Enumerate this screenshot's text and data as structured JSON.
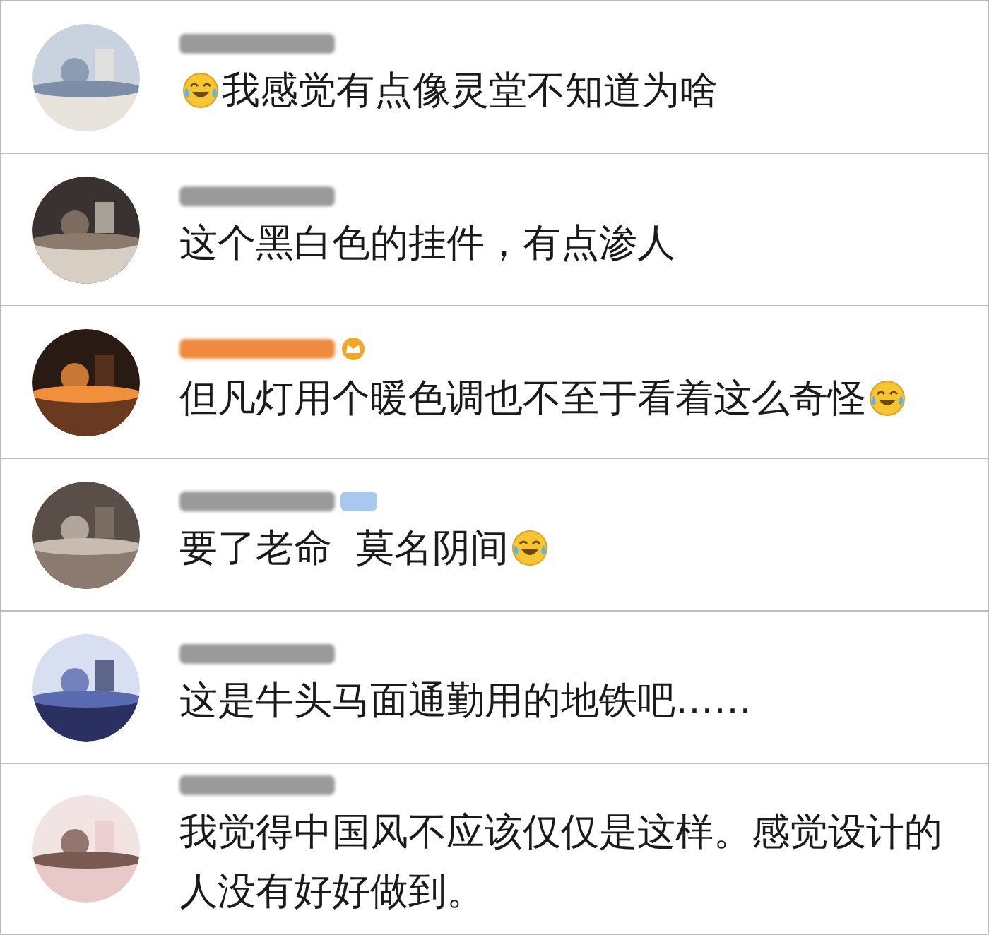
{
  "comments": [
    {
      "username": {
        "color": "#9a9a9a"
      },
      "segments": [
        {
          "kind": "emoji"
        },
        {
          "kind": "text",
          "text": "我感觉有点像灵堂不知道为啥"
        }
      ]
    },
    {
      "username": {
        "color": "#9a9a9a"
      },
      "segments": [
        {
          "kind": "text",
          "text": "这个黑白色的挂件，有点渗人"
        }
      ]
    },
    {
      "username": {
        "color": "#f08a3c"
      },
      "badge": {
        "kind": "crown"
      },
      "segments": [
        {
          "kind": "text",
          "text": "但凡灯用个暖色调也不至于看着这么奇怪"
        },
        {
          "kind": "emoji"
        }
      ]
    },
    {
      "username": {
        "color": "#9a9a9a"
      },
      "badge": {
        "kind": "tag"
      },
      "segments": [
        {
          "kind": "text",
          "text": "要了老命  莫名阴间"
        },
        {
          "kind": "emoji"
        }
      ]
    },
    {
      "username": {
        "color": "#9a9a9a"
      },
      "segments": [
        {
          "kind": "text",
          "text": "这是牛头马面通勤用的地铁吧……"
        }
      ]
    },
    {
      "username": {
        "color": "#9a9a9a"
      },
      "segments": [
        {
          "kind": "text",
          "text": "我觉得中国风不应该仅仅是这样。感觉设计的人没有好好做到。"
        }
      ]
    }
  ]
}
